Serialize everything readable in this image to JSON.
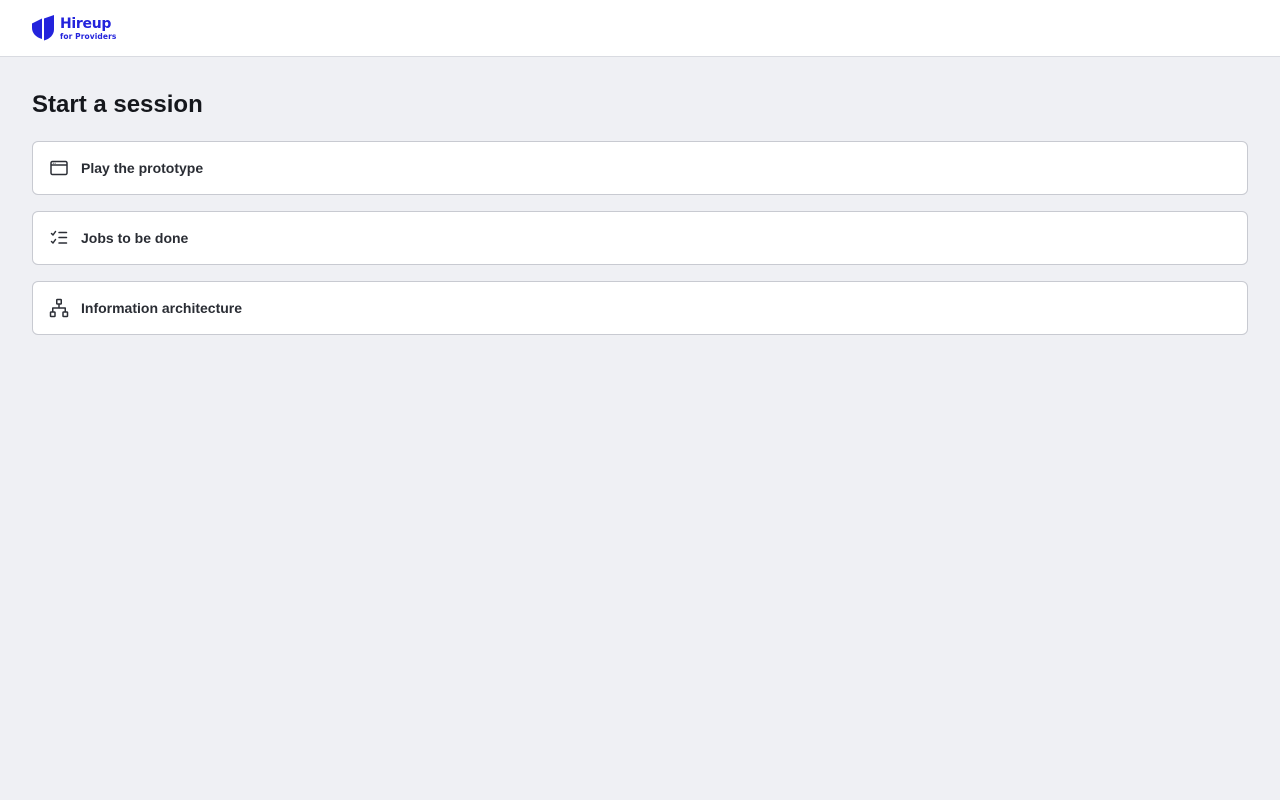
{
  "header": {
    "logo": {
      "name": "Hireup",
      "subtitle": "for Providers",
      "brand_color": "#2323dc"
    }
  },
  "main": {
    "title": "Start a session",
    "sessions": [
      {
        "label": "Play the prototype",
        "icon": "browser-window-icon"
      },
      {
        "label": "Jobs to be done",
        "icon": "checklist-icon"
      },
      {
        "label": "Information architecture",
        "icon": "sitemap-icon"
      }
    ]
  }
}
